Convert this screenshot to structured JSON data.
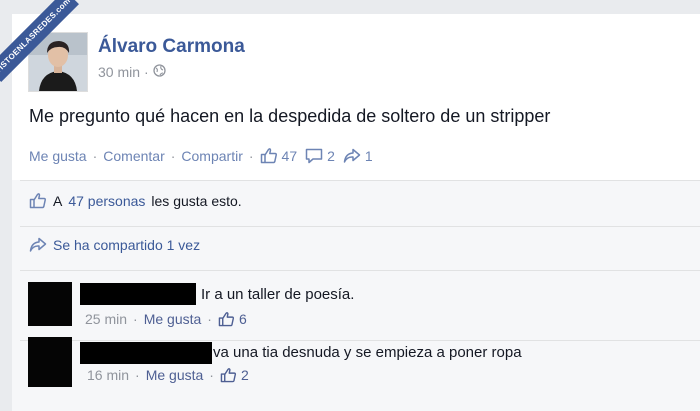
{
  "watermark": {
    "text": "VISTOENLASREDES.com"
  },
  "post": {
    "author": "Álvaro Carmona",
    "time": "30 min",
    "privacy_icon": "globe-icon",
    "text": "Me pregunto qué hacen en la despedida de soltero de un stripper",
    "actions": {
      "like": "Me gusta",
      "comment": "Comentar",
      "share": "Compartir",
      "separator": "·"
    },
    "stats": {
      "likes": "47",
      "comments": "2",
      "shares": "1"
    }
  },
  "summary": {
    "likes_prefix": "A",
    "likes_link": "47 personas",
    "likes_suffix": "les gusta esto.",
    "shares_link": "Se ha compartido 1 vez"
  },
  "comments": [
    {
      "text": "Ir a un taller de poesía.",
      "time": "25 min",
      "like_label": "Me gusta",
      "likes": "6"
    },
    {
      "text": "va una tia desnuda y se empieza a poner ropa",
      "time": "16 min",
      "like_label": "Me gusta",
      "likes": "2"
    }
  ],
  "colors": {
    "link": "#3b5998",
    "muted": "#90949c",
    "background": "#e9ebee",
    "lower_bg": "#f6f7f9"
  }
}
